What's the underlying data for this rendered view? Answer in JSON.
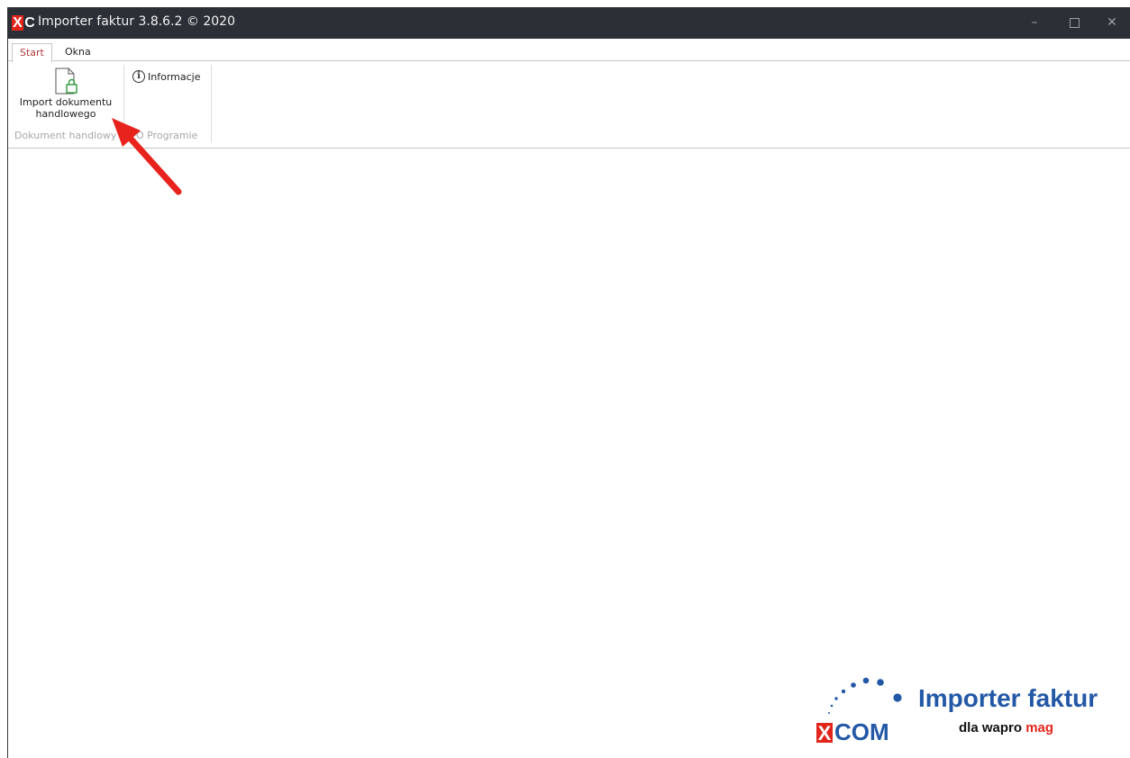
{
  "titlebar": {
    "logo_x": "X",
    "logo_c": "C",
    "title": "Importer faktur 3.8.6.2 © 2020",
    "minimize_glyph": "–",
    "close_glyph": "✕"
  },
  "tabs": [
    {
      "label": "Start",
      "active": true
    },
    {
      "label": "Okna",
      "active": false
    }
  ],
  "ribbon": {
    "import_button": {
      "line1": "Import dokumentu",
      "line2": "handlowego",
      "icon": "document-lock-icon"
    },
    "group1_label": "Dokument handlowy",
    "info_button": {
      "label": "Informacje",
      "icon": "info-icon",
      "icon_glyph": "i"
    },
    "group2_label": "O Programie"
  },
  "branding": {
    "title": "Importer faktur",
    "xcom_x": "X",
    "xcom_rest": "COM",
    "sub_prefix": "dla wapro ",
    "sub_mag": "mag"
  },
  "colors": {
    "titlebar_bg": "#2b2f36",
    "brand_blue": "#2358a6",
    "brand_red": "#e1251b",
    "active_tab_text": "#b23a3a",
    "arrow": "#e8231e"
  }
}
